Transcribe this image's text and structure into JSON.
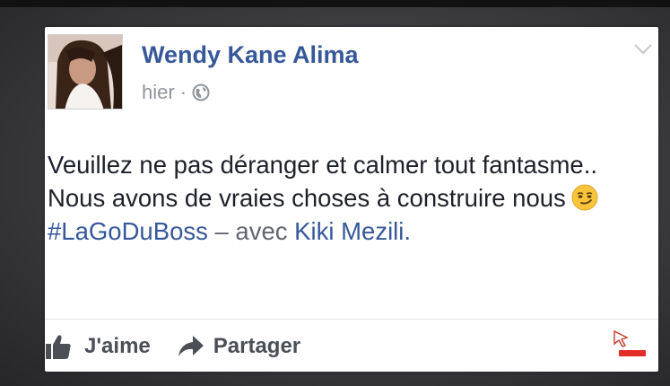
{
  "post": {
    "author": "Wendy Kane Alima",
    "time": "hier",
    "separator": "·",
    "privacy_icon": "globe-icon",
    "options_icon": "chevron-down-icon",
    "text_line1": "Veuillez ne pas déranger et calmer tout fantasme..",
    "text_line2": "Nous avons de vraies choses à construire nous",
    "emoji": "smirking-face-emoji",
    "hashtag": "#LaGoDuBoss",
    "with_text": " – avec ",
    "tagged_person": "Kiki Mezili."
  },
  "actions": {
    "like_label": "J'aime",
    "like_icon": "thumbs-up-icon",
    "share_label": "Partager",
    "share_icon": "share-arrow-icon"
  },
  "colors": {
    "link": "#365899",
    "text": "#1d2129",
    "meta": "#90949c",
    "action_text": "#4b4f56",
    "background": "#3a3a3d",
    "badge": "#e52d27"
  }
}
